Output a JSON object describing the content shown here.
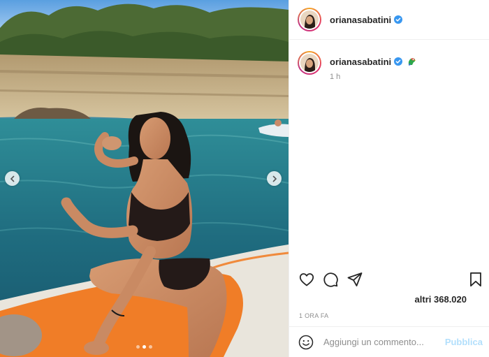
{
  "post": {
    "media": {
      "photo_label": "beach-photo",
      "carousel": {
        "slides": 3,
        "active": 2
      }
    },
    "author": {
      "username": "orianasabatini",
      "verified": true
    },
    "caption": {
      "username": "orianasabatini",
      "emoji": "parrot-emoji",
      "time": "1 h"
    },
    "likes": "altri 368.020",
    "posted_ago": "1 ORA FA",
    "comment": {
      "placeholder": "Aggiungi un commento...",
      "publish_label": "Pubblica"
    },
    "colors": {
      "verified_blue": "#3897f0",
      "publish_disabled": "#b2dffc",
      "text_secondary": "#8e8e8e"
    },
    "icons": [
      "chevron-left-icon",
      "chevron-right-icon",
      "heart-icon",
      "comment-icon",
      "share-icon",
      "bookmark-icon",
      "emoji-smile-icon",
      "verified-badge-icon"
    ]
  }
}
